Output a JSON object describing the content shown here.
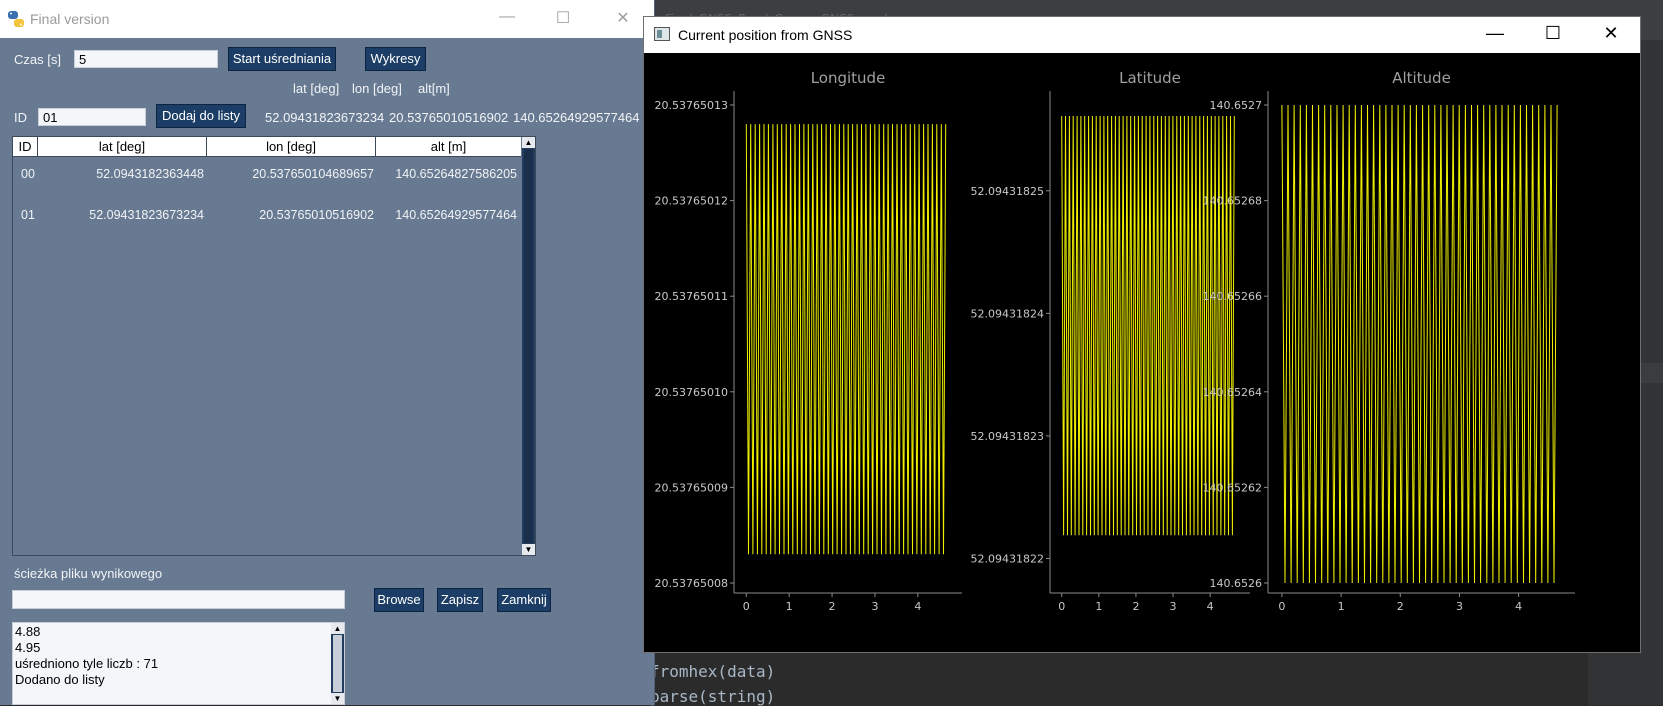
{
  "ide": {
    "tab_text": "   Final_GNSS_Read_Com ... GNSS_read.py",
    "code_lines": [
      "fromhex(data)",
      "parse(string)"
    ]
  },
  "app": {
    "title": "Final version",
    "czas_label": "Czas [s]",
    "czas_value": "5",
    "start_button": "Start uśredniania",
    "wykresy_button": "Wykresy",
    "header_lat": "lat [deg]",
    "header_lon": "lon [deg]",
    "header_alt": "alt[m]",
    "id_label": "ID",
    "id_value": "01",
    "dodaj_button": "Dodaj do listy",
    "current_lat": "52.09431823673234",
    "current_lon": "20.53765010516902",
    "current_alt": "140.65264929577464",
    "table": {
      "columns": [
        "ID",
        "lat [deg]",
        "lon [deg]",
        "alt [m]"
      ],
      "rows": [
        {
          "id": "00",
          "lat": "52.0943182363448",
          "lon": "20.537650104689657",
          "alt": "140.65264827586205"
        },
        {
          "id": "01",
          "lat": "52.09431823673234",
          "lon": "20.53765010516902",
          "alt": "140.65264929577464"
        }
      ]
    },
    "path_label": "ścieżka pliku wynikowego",
    "path_value": "",
    "browse_button": "Browse",
    "zapisz_button": "Zapisz",
    "zamknij_button": "Zamknij",
    "log_lines": [
      "4.88",
      "4.95",
      "uśredniono tyle liczb : 71",
      "Dodano do listy"
    ]
  },
  "gnss_window": {
    "title": "Current position from GNSS",
    "line_color": "#f0f000"
  },
  "chart_data": [
    {
      "type": "line",
      "title": "Longitude",
      "x_ticks": [
        "0",
        "1",
        "2",
        "3",
        "4"
      ],
      "y_ticks": [
        "20.53765013",
        "20.53765012",
        "20.53765011",
        "20.53765010",
        "20.53765009",
        "20.53765008"
      ],
      "y_tick_values": [
        20.53765013,
        20.53765012,
        20.53765011,
        20.5376501,
        20.53765009,
        20.53765008
      ],
      "xlim": [
        -0.1,
        4.75
      ],
      "ylim": [
        20.53765008,
        20.53765013
      ],
      "series_range": [
        20.537650083,
        20.537650128
      ],
      "oscillations": 45
    },
    {
      "type": "line",
      "title": "Latitude",
      "x_ticks": [
        "0",
        "1",
        "2",
        "3",
        "4"
      ],
      "y_ticks": [
        "52.09431825",
        "52.09431824",
        "52.09431823",
        "52.09431822"
      ],
      "y_tick_values": [
        52.09431825,
        52.09431824,
        52.09431823,
        52.09431822
      ],
      "xlim": [
        -0.1,
        4.75
      ],
      "ylim": [
        52.094318218,
        52.094318257
      ],
      "series_range": [
        52.0943182219,
        52.0943182561
      ],
      "oscillations": 45
    },
    {
      "type": "line",
      "title": "Altitude",
      "x_ticks": [
        "0",
        "1",
        "2",
        "3",
        "4"
      ],
      "y_ticks": [
        "140.6527",
        "140.65268",
        "140.65266",
        "140.65264",
        "140.65262",
        "140.6526"
      ],
      "y_tick_values": [
        140.6527,
        140.65268,
        140.65266,
        140.65264,
        140.65262,
        140.6526
      ],
      "xlim": [
        -0.1,
        4.75
      ],
      "ylim": [
        140.6526,
        140.6527
      ],
      "series_range": [
        140.6526,
        140.6527
      ],
      "oscillations": 45
    }
  ]
}
